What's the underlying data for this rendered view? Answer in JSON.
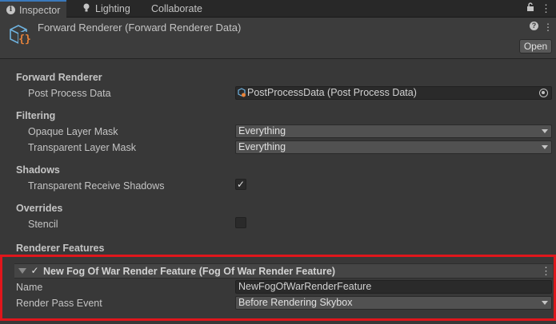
{
  "tabs": [
    {
      "label": "Inspector",
      "icon": "info-icon",
      "active": true
    },
    {
      "label": "Lighting",
      "icon": "lightbulb-icon",
      "active": false
    },
    {
      "label": "Collaborate",
      "icon": "",
      "active": false
    }
  ],
  "header": {
    "title": "Forward Renderer (Forward Renderer Data)",
    "open_label": "Open",
    "icons": [
      "help-icon",
      "kebab-menu-icon"
    ]
  },
  "sections": {
    "forward_renderer": "Forward Renderer",
    "filtering": "Filtering",
    "shadows": "Shadows",
    "overrides": "Overrides",
    "renderer_features": "Renderer Features"
  },
  "fields": {
    "post_process_label": "Post Process Data",
    "post_process_value": "PostProcessData (Post Process Data)",
    "opaque_label": "Opaque Layer Mask",
    "opaque_value": "Everything",
    "transparent_label": "Transparent Layer Mask",
    "transparent_value": "Everything",
    "transparent_shadows_label": "Transparent Receive Shadows",
    "transparent_shadows_checked": true,
    "stencil_label": "Stencil",
    "stencil_checked": false
  },
  "feature": {
    "title": "New Fog Of War Render Feature (Fog Of War Render Feature)",
    "enabled": true,
    "name_label": "Name",
    "name_value": "NewFogOfWarRenderFeature",
    "event_label": "Render Pass Event",
    "event_value": "Before Rendering Skybox"
  },
  "checkmark": "✓",
  "colors": {
    "background": "#383838",
    "tab_active_accent": "#3a79bb",
    "highlight_border": "#e0161c"
  }
}
